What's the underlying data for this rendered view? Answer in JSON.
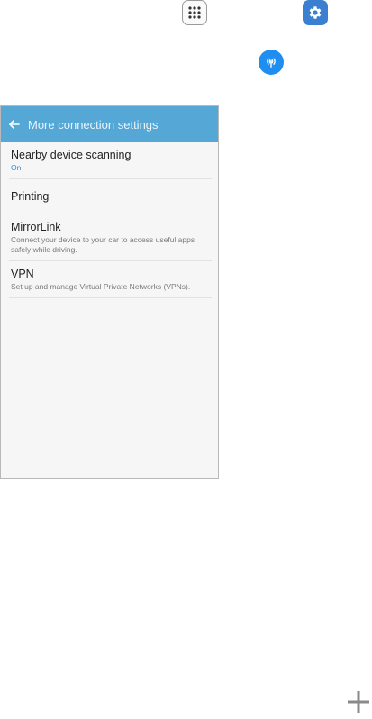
{
  "icons": {
    "apps": "apps-grid-icon",
    "settings": "gear-icon",
    "hotspot": "hotspot-icon",
    "back": "back-arrow-icon",
    "plus": "plus-icon"
  },
  "colors": {
    "appbar": "#55a8d6",
    "accent_text": "#2d8fd0",
    "settings_tile": "#3b7fd1",
    "hotspot_tile": "#1f8ef0"
  },
  "screen": {
    "title": "More connection settings",
    "items": [
      {
        "title": "Nearby device scanning",
        "subtitle": "On"
      },
      {
        "title": "Printing",
        "subtitle": ""
      },
      {
        "title": "MirrorLink",
        "subtitle": "Connect your device to your car to access useful apps safely while driving."
      },
      {
        "title": "VPN",
        "subtitle": "Set up and manage Virtual Private Networks (VPNs)."
      }
    ]
  }
}
